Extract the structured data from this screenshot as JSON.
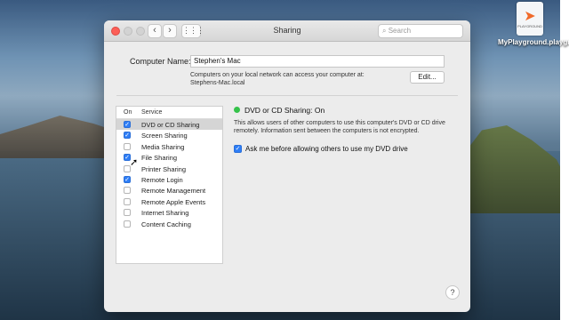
{
  "window": {
    "title": "Sharing"
  },
  "toolbar": {
    "back": "‹",
    "forward": "›",
    "grid": "⋮⋮⋮",
    "search_placeholder": "Search"
  },
  "computer_name": {
    "label": "Computer Name:",
    "value": "Stephen's Mac",
    "info_line1": "Computers on your local network can access your computer at:",
    "info_line2": "Stephens-Mac.local",
    "edit_label": "Edit..."
  },
  "services": {
    "header_on": "On",
    "header_service": "Service",
    "items": [
      {
        "name": "DVD or CD Sharing",
        "checked": true,
        "selected": true
      },
      {
        "name": "Screen Sharing",
        "checked": true,
        "selected": false
      },
      {
        "name": "Media Sharing",
        "checked": false,
        "selected": false
      },
      {
        "name": "File Sharing",
        "checked": true,
        "selected": false
      },
      {
        "name": "Printer Sharing",
        "checked": false,
        "selected": false
      },
      {
        "name": "Remote Login",
        "checked": true,
        "selected": false
      },
      {
        "name": "Remote Management",
        "checked": false,
        "selected": false
      },
      {
        "name": "Remote Apple Events",
        "checked": false,
        "selected": false
      },
      {
        "name": "Internet Sharing",
        "checked": false,
        "selected": false
      },
      {
        "name": "Content Caching",
        "checked": false,
        "selected": false
      }
    ]
  },
  "detail": {
    "status": "DVD or CD Sharing: On",
    "status_color": "#35c24a",
    "description": "This allows users of other computers to use this computer's DVD or CD drive remotely. Information sent between the computers is not encrypted.",
    "ask_label": "Ask me before allowing others to use my DVD drive",
    "ask_checked": true
  },
  "help": "?",
  "desktop_file": {
    "name": "MyPlayground.playground",
    "badge": "PLAYGROUND"
  },
  "accent_color": "#2f7ef6"
}
